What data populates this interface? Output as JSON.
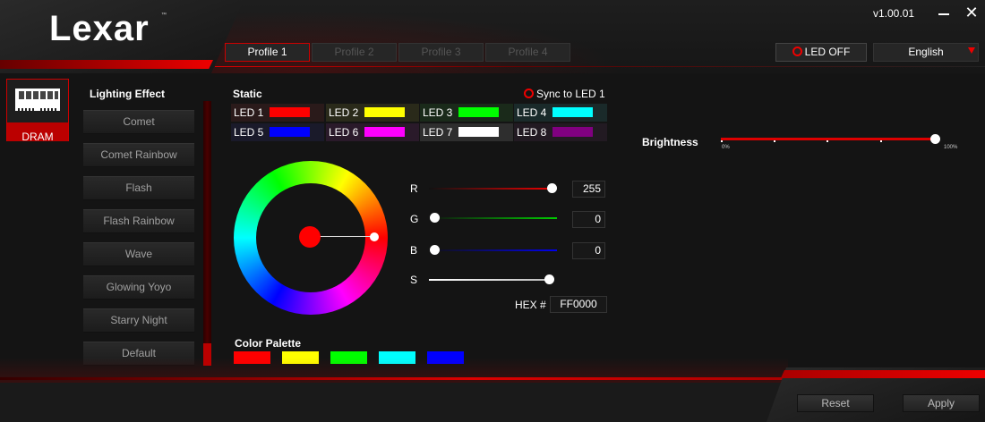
{
  "app": {
    "logo": "Lexar",
    "trademark": "™",
    "version": "v1.00.01"
  },
  "profiles": [
    {
      "label": "Profile 1",
      "active": true
    },
    {
      "label": "Profile 2",
      "active": false
    },
    {
      "label": "Profile 3",
      "active": false
    },
    {
      "label": "Profile 4",
      "active": false
    }
  ],
  "header": {
    "led_off_label": "LED OFF",
    "language": "English"
  },
  "device": {
    "label": "DRAM"
  },
  "lighting": {
    "title": "Lighting Effect",
    "effects": [
      "Comet",
      "Comet Rainbow",
      "Flash",
      "Flash Rainbow",
      "Wave",
      "Glowing Yoyo",
      "Starry Night",
      "Default"
    ]
  },
  "static": {
    "title": "Static",
    "sync_label": "Sync to LED 1",
    "leds": [
      {
        "label": "LED 1",
        "color": "#FF0000",
        "bg": "#2a1a1a"
      },
      {
        "label": "LED 2",
        "color": "#FFFF00",
        "bg": "#2a2a1a"
      },
      {
        "label": "LED 3",
        "color": "#00FF00",
        "bg": "#1a2a1a"
      },
      {
        "label": "LED 4",
        "color": "#00FFFF",
        "bg": "#1a2a2a"
      },
      {
        "label": "LED 5",
        "color": "#0000FF",
        "bg": "#1a1a2a"
      },
      {
        "label": "LED 6",
        "color": "#FF00FF",
        "bg": "#2a1a2a"
      },
      {
        "label": "LED 7",
        "color": "#FFFFFF",
        "bg": "#2e2e2e"
      },
      {
        "label": "LED 8",
        "color": "#800080",
        "bg": "#221a22"
      }
    ]
  },
  "sliders": {
    "r": {
      "label": "R",
      "value": "255"
    },
    "g": {
      "label": "G",
      "value": "0"
    },
    "b": {
      "label": "B",
      "value": "0"
    },
    "s": {
      "label": "S"
    },
    "hex_label": "HEX #",
    "hex_value": "FF0000"
  },
  "palette": {
    "title": "Color Palette",
    "colors": [
      "#FF0000",
      "#FFFF00",
      "#00FF00",
      "#00FFFF",
      "#0000FF"
    ]
  },
  "brightness": {
    "title": "Brightness",
    "min_label": "0%",
    "max_label": "100%",
    "level_percent": 100
  },
  "footer": {
    "reset_label": "Reset",
    "apply_label": "Apply"
  },
  "icons": {
    "minimize": "minimize-icon",
    "close": "close-icon",
    "dram": "ram-stick-icon",
    "dropdown": "dropdown-arrow-icon"
  }
}
